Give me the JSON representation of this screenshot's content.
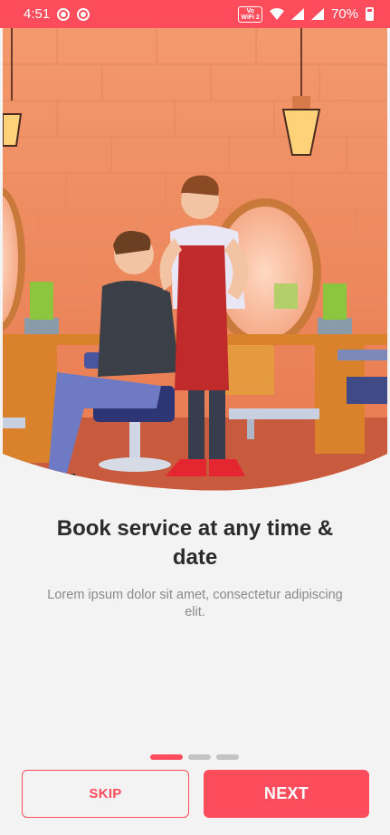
{
  "status_bar": {
    "time": "4:51",
    "volte_label_top": "Vo",
    "volte_label_bottom": "WiFi 2",
    "battery": "70%"
  },
  "onboarding": {
    "title": "Book service at any time & date",
    "description": "Lorem ipsum dolor sit amet, consectetur adipiscing elit.",
    "page_count": 3,
    "active_page": 1
  },
  "buttons": {
    "skip": "SKIP",
    "next": "NEXT"
  },
  "colors": {
    "accent": "#fd4d5c",
    "background": "#f3f3f3"
  }
}
